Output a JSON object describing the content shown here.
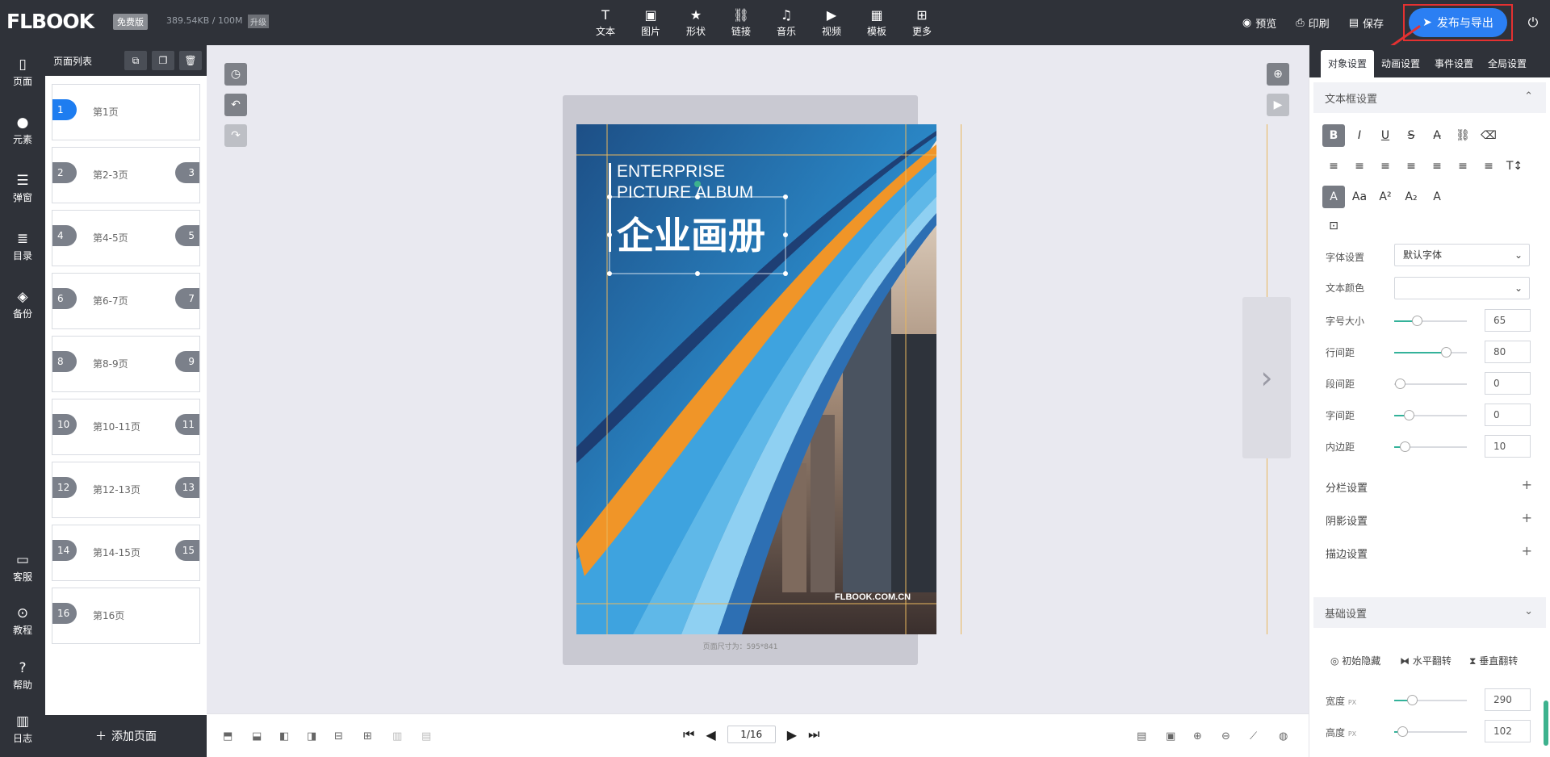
{
  "app": {
    "logo": "FLBOOK",
    "edition": "免费版",
    "storage": "389.54KB / 100M",
    "upgrade": "升级"
  },
  "toolbar": {
    "items": [
      {
        "label": "文本",
        "icon": "text-icon"
      },
      {
        "label": "图片",
        "icon": "image-icon"
      },
      {
        "label": "形状",
        "icon": "star-icon"
      },
      {
        "label": "链接",
        "icon": "link-icon"
      },
      {
        "label": "音乐",
        "icon": "music-icon"
      },
      {
        "label": "视频",
        "icon": "video-icon"
      },
      {
        "label": "模板",
        "icon": "template-icon"
      },
      {
        "label": "更多",
        "icon": "more-icon"
      }
    ],
    "preview": "预览",
    "print": "印刷",
    "save": "保存",
    "publish": "发布与导出"
  },
  "leftnav": [
    {
      "label": "页面",
      "icon": "page-icon"
    },
    {
      "label": "元素",
      "icon": "element-icon"
    },
    {
      "label": "弹窗",
      "icon": "popup-icon"
    },
    {
      "label": "目录",
      "icon": "list-icon"
    },
    {
      "label": "备份",
      "icon": "layers-icon"
    },
    {
      "label": "客服",
      "icon": "chat-icon"
    },
    {
      "label": "教程",
      "icon": "play-icon"
    },
    {
      "label": "帮助",
      "icon": "help-icon"
    },
    {
      "label": "日志",
      "icon": "log-icon"
    }
  ],
  "pagelist": {
    "title": "页面列表",
    "pages": [
      {
        "left": "1",
        "right": "",
        "label": "第1页"
      },
      {
        "left": "2",
        "right": "3",
        "label": "第2-3页"
      },
      {
        "left": "4",
        "right": "5",
        "label": "第4-5页"
      },
      {
        "left": "6",
        "right": "7",
        "label": "第6-7页"
      },
      {
        "left": "8",
        "right": "9",
        "label": "第8-9页"
      },
      {
        "left": "10",
        "right": "11",
        "label": "第10-11页"
      },
      {
        "left": "12",
        "right": "13",
        "label": "第12-13页"
      },
      {
        "left": "14",
        "right": "15",
        "label": "第14-15页"
      },
      {
        "left": "16",
        "right": "",
        "label": "第16页"
      }
    ],
    "add": "添加页面"
  },
  "canvas": {
    "cover_en_1": "ENTERPRISE",
    "cover_en_2": "PICTURE ALBUM",
    "cover_cn": "企业画册",
    "cover_url": "FLBOOK.COM.CN",
    "page_size": "页面尺寸为：595*841"
  },
  "pager": {
    "current": "1/16"
  },
  "rpanel": {
    "tabs": [
      "对象设置",
      "动画设置",
      "事件设置",
      "全局设置"
    ],
    "textbox_title": "文本框设置",
    "font_label": "字体设置",
    "font_value": "默认字体",
    "color_label": "文本颜色",
    "size_label": "字号大小",
    "size_value": "65",
    "line_label": "行间距",
    "line_value": "80",
    "para_label": "段间距",
    "para_value": "0",
    "char_label": "字间距",
    "char_value": "0",
    "pad_label": "内边距",
    "pad_value": "10",
    "columns": "分栏设置",
    "shadow": "阴影设置",
    "stroke": "描边设置",
    "basic_title": "基础设置",
    "hide_init": "初始隐藏",
    "flip_h": "水平翻转",
    "flip_v": "垂直翻转",
    "width_label": "宽度",
    "width_unit": "PX",
    "width_value": "290",
    "height_label": "高度",
    "height_unit": "PX",
    "height_value": "102"
  }
}
